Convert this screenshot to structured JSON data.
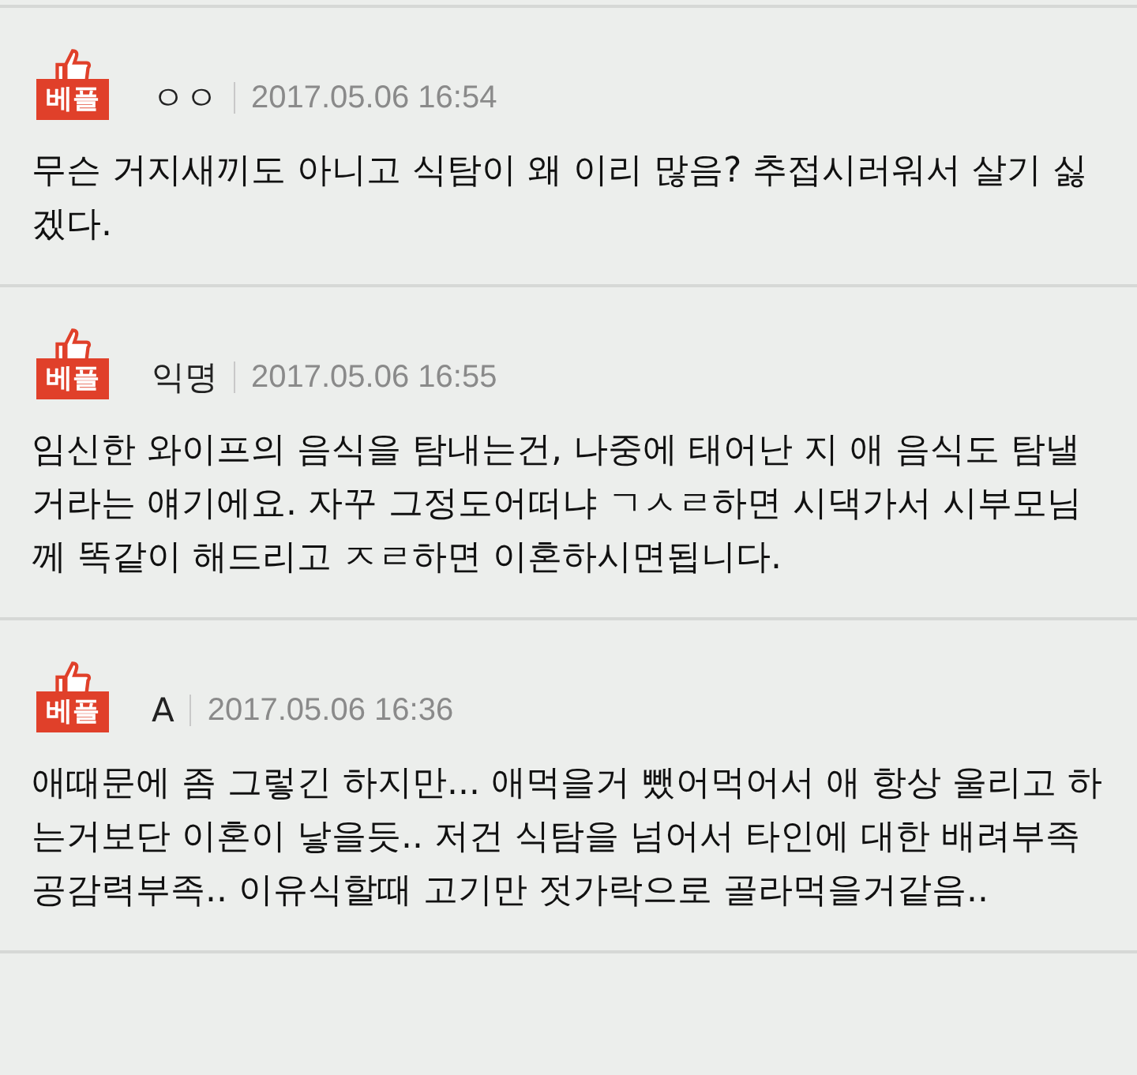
{
  "comments": [
    {
      "badge": "베플",
      "author": "ㅇㅇ",
      "date": "2017.05.06 16:54",
      "text": "무슨 거지새끼도 아니고 식탐이 왜 이리 많음? 추접시러워서 살기 싫겠다."
    },
    {
      "badge": "베플",
      "author": "익명",
      "date": "2017.05.06 16:55",
      "text": "임신한 와이프의 음식을 탐내는건, 나중에 태어난 지 애 음식도 탐낼거라는 얘기에요. 자꾸 그정도어떠냐 ㄱㅅㄹ하면 시댁가서 시부모님께 똑같이 해드리고 ㅈㄹ하면 이혼하시면됩니다."
    },
    {
      "badge": "베플",
      "author": "A",
      "date": "2017.05.06 16:36",
      "text": "애때문에 좀 그렇긴 하지만... 애먹을거 뺐어먹어서 애 항상 울리고 하는거보단 이혼이 낳을듯.. 저건 식탐을 넘어서 타인에 대한 배려부족 공감력부족.. 이유식할때 고기만 젓가락으로 골라먹을거같음.."
    }
  ]
}
